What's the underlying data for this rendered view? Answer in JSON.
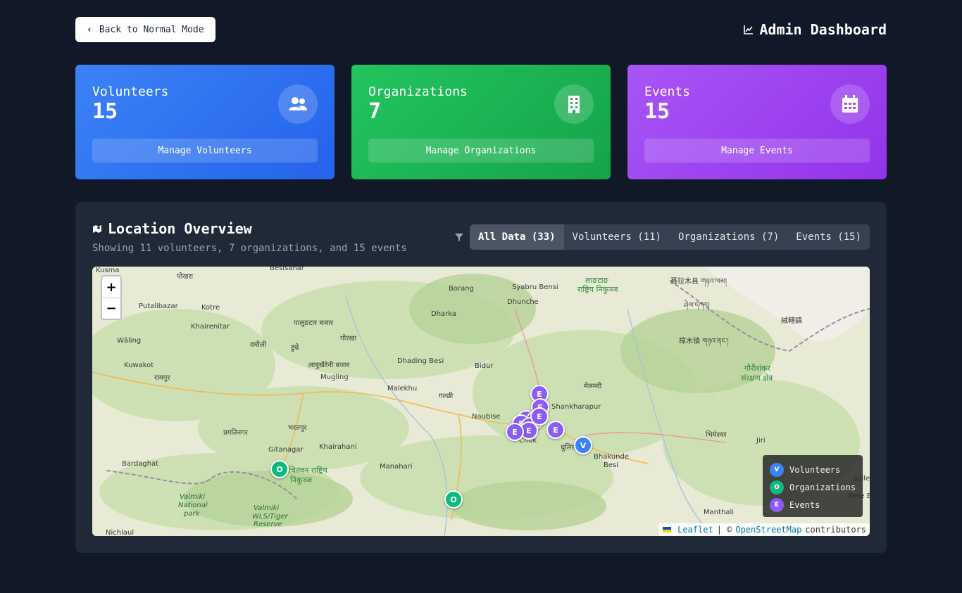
{
  "topbar": {
    "back_label": "Back to Normal Mode",
    "title": "Admin Dashboard"
  },
  "cards": {
    "volunteers": {
      "label": "Volunteers",
      "count": "15",
      "button": "Manage Volunteers"
    },
    "organizations": {
      "label": "Organizations",
      "count": "7",
      "button": "Manage Organizations"
    },
    "events": {
      "label": "Events",
      "count": "15",
      "button": "Manage Events"
    }
  },
  "location": {
    "title": "Location Overview",
    "subtitle": "Showing 11 volunteers, 7 organizations, and 15 events",
    "filters": [
      "All Data (33)",
      "Volunteers (11)",
      "Organizations (7)",
      "Events (15)"
    ],
    "active_filter": "All Data (33)"
  },
  "map": {
    "zoom_in": "+",
    "zoom_out": "−",
    "places": [
      "Kusma",
      "पोखरा",
      "Besisahar",
      "Putalibazar",
      "Kotre",
      "Khairenitar",
      "Wāling",
      "पालुङटार बजार",
      "गोरखा",
      "Borang",
      "Syabru Bensi",
      "Dhunche",
      "Dharka",
      "लाङटाङ",
      "राष्ट्रिय निकुञ्ज",
      "聂拉木县 གཉའ་ལམ།",
      "गौरीशंकर",
      "संरक्षण क्षेत्र",
      "Kuwakot",
      "रामपुर",
      "दमौली",
      "डुम्रे",
      "आबुखैरेनी बजार",
      "Mugling",
      "Dhading Besi",
      "Bidur",
      "Malekhu",
      "गल्छी",
      "मेलम्ची",
      "Shankharapur",
      "Naubise",
      "Chok",
      "धुलिखेल",
      "Bhakunde",
      "Besi",
      "भरतपुर",
      "प्रगतिनगर",
      "Gitanagar",
      "Khairahani",
      "Manahari",
      "Bardaghat",
      "Valmiki",
      "National",
      "park",
      "Valmiki",
      "WLS/Tiger",
      "Reserve",
      "Nichlaul",
      "Manthali",
      "Jiri",
      "भिमेश्वर",
      "Salleri",
      "Nele Bazar",
      "樟木镇 གཉའ་ནང་།",
      "絨轄鎮",
      "ཤེལ་དཀར།",
      "चितवन राष्ट्रिय",
      "निकुञ्ज"
    ],
    "markers": [
      "E",
      "E",
      "E",
      "E",
      "E",
      "E",
      "E",
      "E",
      "E",
      "E",
      "V",
      "O",
      "O"
    ],
    "legend": [
      {
        "key": "V",
        "label": "Volunteers",
        "color": "#3b82f6"
      },
      {
        "key": "O",
        "label": "Organizations",
        "color": "#10b981"
      },
      {
        "key": "E",
        "label": "Events",
        "color": "#8b5cf6"
      }
    ],
    "attribution": {
      "leaflet": "Leaflet",
      "sep": "| ©",
      "osm": "OpenStreetMap",
      "contrib": "contributors"
    }
  },
  "colors": {
    "volunteers": "#3b82f6",
    "organizations": "#10b981",
    "events": "#8b5cf6",
    "background": "#111827",
    "panel": "#1f2937"
  }
}
